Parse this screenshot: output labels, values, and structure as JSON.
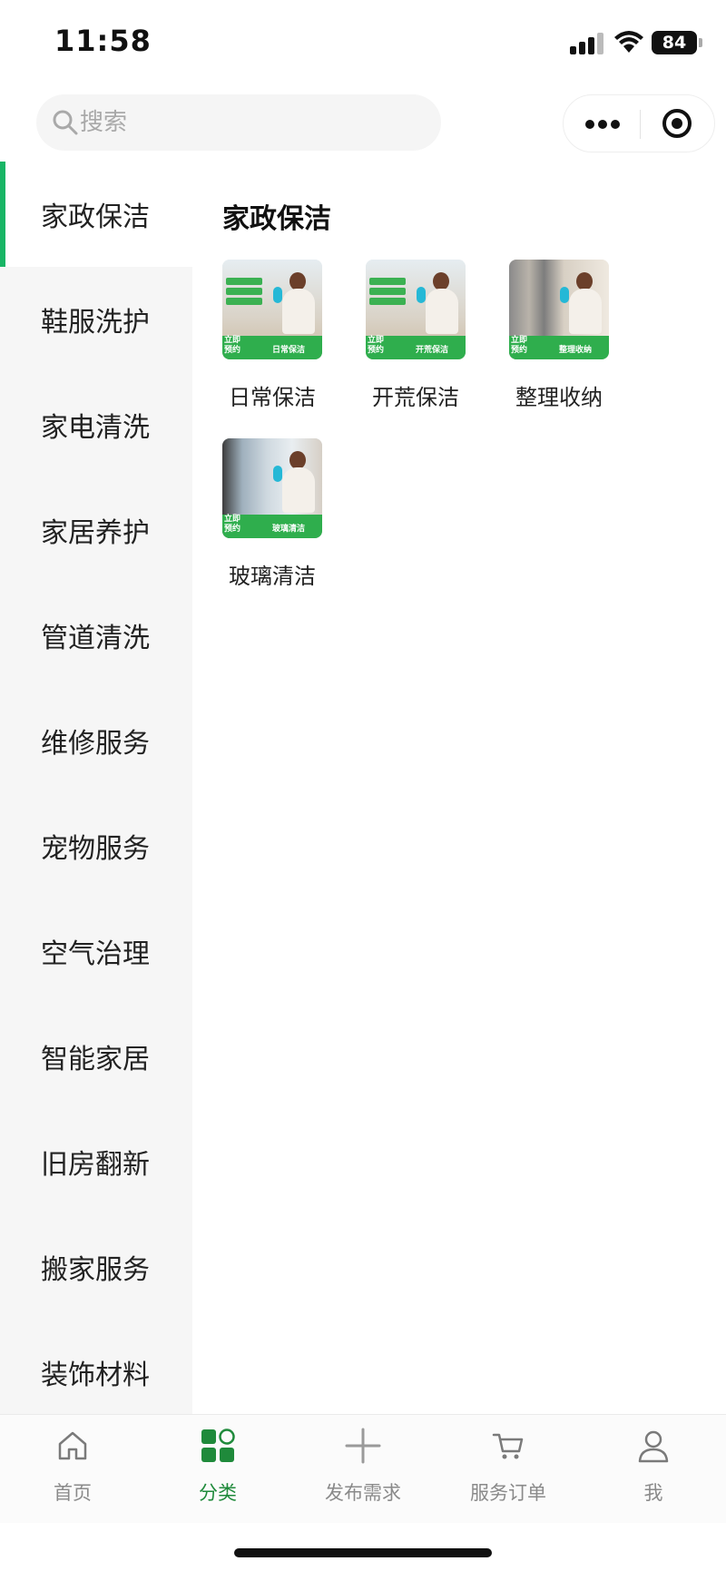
{
  "status_bar": {
    "time": "11:58",
    "battery": "84"
  },
  "search": {
    "placeholder": "搜索"
  },
  "sidebar": {
    "items": [
      {
        "label": "家政保洁",
        "active": true
      },
      {
        "label": "鞋服洗护"
      },
      {
        "label": "家电清洗"
      },
      {
        "label": "家居养护"
      },
      {
        "label": "管道清洗"
      },
      {
        "label": "维修服务"
      },
      {
        "label": "宠物服务"
      },
      {
        "label": "空气治理"
      },
      {
        "label": "智能家居"
      },
      {
        "label": "旧房翻新"
      },
      {
        "label": "搬家服务"
      },
      {
        "label": "装饰材料"
      }
    ]
  },
  "content": {
    "title": "家政保洁",
    "services": [
      {
        "label": "日常保洁",
        "banner_badge": "立即预约",
        "banner_text": "日常保洁"
      },
      {
        "label": "开荒保洁",
        "banner_badge": "立即预约",
        "banner_text": "开荒保洁"
      },
      {
        "label": "整理收纳",
        "banner_badge": "立即预约",
        "banner_text": "整理收纳"
      },
      {
        "label": "玻璃清洁",
        "banner_badge": "立即预约",
        "banner_text": "玻璃清洁"
      }
    ]
  },
  "tabbar": {
    "tabs": [
      {
        "label": "首页",
        "icon": "home-icon"
      },
      {
        "label": "分类",
        "icon": "category-icon",
        "active": true
      },
      {
        "label": "发布需求",
        "icon": "plus-icon"
      },
      {
        "label": "服务订单",
        "icon": "cart-icon"
      },
      {
        "label": "我",
        "icon": "user-icon"
      }
    ]
  },
  "colors": {
    "accent": "#18b565",
    "active_tab": "#1f8a3b",
    "sidebar_bg": "#f6f6f6"
  }
}
